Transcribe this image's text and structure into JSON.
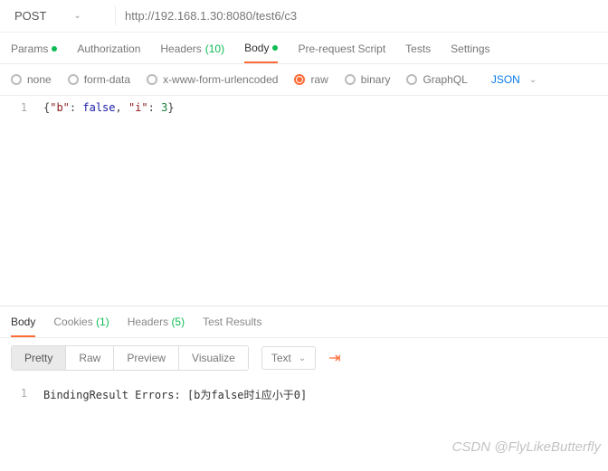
{
  "request": {
    "method": "POST",
    "url": "http://192.168.1.30:8080/test6/c3"
  },
  "tabs": {
    "params": "Params",
    "authorization": "Authorization",
    "headers": "Headers",
    "headers_count": "(10)",
    "body": "Body",
    "prerequest": "Pre-request Script",
    "tests": "Tests",
    "settings": "Settings"
  },
  "body_types": {
    "none": "none",
    "formdata": "form-data",
    "urlencoded": "x-www-form-urlencoded",
    "raw": "raw",
    "binary": "binary",
    "graphql": "GraphQL",
    "format": "JSON"
  },
  "request_body": {
    "line1": {
      "num": "1",
      "key1": "\"b\"",
      "val1": "false",
      "key2": "\"i\"",
      "val2": "3"
    }
  },
  "response_tabs": {
    "body": "Body",
    "cookies": "Cookies",
    "cookies_count": "(1)",
    "headers": "Headers",
    "headers_count": "(5)",
    "testresults": "Test Results"
  },
  "response_controls": {
    "pretty": "Pretty",
    "raw": "Raw",
    "preview": "Preview",
    "visualize": "Visualize",
    "format": "Text"
  },
  "response_body": {
    "line1_num": "1",
    "line1_text": "BindingResult Errors: [b为false时i应小于0]"
  },
  "watermark": "CSDN @FlyLikeButterfly"
}
